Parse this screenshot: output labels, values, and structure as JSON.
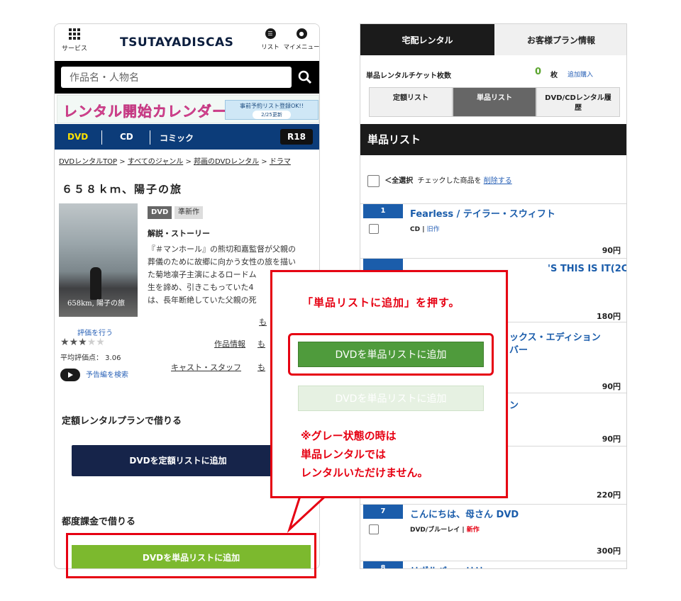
{
  "left": {
    "header": {
      "service_label": "サービス",
      "logo": "TSUTAYADISCAS",
      "list_label": "リスト",
      "mymenu_label": "マイメニュー"
    },
    "search": {
      "placeholder": "作品名・人物名"
    },
    "banner": {
      "title": "レンタル開始カレンダー",
      "box_text": "事前予約リスト登録OK!!",
      "box_date": "2/25更新"
    },
    "categories": [
      "DVD",
      "CD",
      "コミック"
    ],
    "r18": "R18",
    "breadcrumb": [
      "DVDレンタルTOP",
      "すべてのジャンル",
      "邦画のDVDレンタル",
      "ドラマ"
    ],
    "breadcrumb_sep": ">",
    "movie_title": "６５８ｋｍ、陽子の旅",
    "poster_text": "658km, 陽子の旅",
    "badges": {
      "format": "DVD",
      "status": "準新作"
    },
    "story_heading": "解説・ストーリー",
    "story_lines": [
      "『＃マンホール』の熊切和嘉監督が父親の",
      "葬儀のために故郷に向かう女性の旅を描い",
      "た菊地凛子主演によるロードム",
      "生を諦め、引きこもっていた4",
      "は、長年断絶していた父親の死"
    ],
    "more_links": [
      "も",
      "も",
      "も"
    ],
    "rate_link": "評価を行う",
    "stars": {
      "rating": 3,
      "max": 5
    },
    "avg_label": "平均評価点： 3.06",
    "trailer_link": "予告編を検索",
    "info_link": "作品情報",
    "cast_link": "キャスト・スタッフ",
    "plan_heading": "定額レンタルプランで借りる",
    "plan_button": "DVDを定額リストに追加",
    "pay_heading": "都度課金で借りる",
    "pay_button": "DVDを単品リストに追加"
  },
  "right": {
    "tabs": [
      "宅配レンタル",
      "お客様プラン情報"
    ],
    "ticket_label": "単品レンタルチケット枚数",
    "ticket_count": "0",
    "ticket_unit": "枚",
    "ticket_link": "追加購入",
    "sub_tabs": [
      "定額リスト",
      "単品リスト",
      "DVD/CDレンタル履\n歴"
    ],
    "list_heading": "単品リスト",
    "select_all": "＜全選択",
    "select_prefix": "チェックした商品を",
    "select_action": "削除する",
    "items": [
      {
        "num": "1",
        "title": "Fearless",
        "sub": " / テイラー・スウィフト",
        "media": "CD",
        "tag": "旧作",
        "price": "90円"
      },
      {
        "num": "",
        "title": "",
        "sub": "'S THIS IS IT(2CD) / マ",
        "media": "",
        "tag": "",
        "price": "180円"
      },
      {
        "num": "",
        "title": "",
        "sub": "ックス・エディション",
        "sub2": "バー",
        "media": "",
        "tag": "",
        "price": "90円"
      },
      {
        "num": "",
        "title": "",
        "sub": "ン",
        "media": "",
        "tag": "",
        "price": "90円"
      },
      {
        "num": "",
        "title": "",
        "sub": "",
        "media": "",
        "tag": "",
        "price": "220円"
      },
      {
        "num": "7",
        "title": "こんにちは、母さん DVD",
        "sub": "",
        "media": "DVD/ブルーレイ",
        "tag": "新作",
        "price": "300円"
      },
      {
        "num": "8",
        "title": "リボルバー・リリー",
        "sub": "",
        "media": "",
        "tag": "",
        "price": ""
      }
    ]
  },
  "callout": {
    "heading": "「単品リストに追加」を押す。",
    "active_button": "DVDを単品リストに追加",
    "disabled_button": "DVDを単品リストに追加",
    "note_lines": [
      "※グレー状態の時は",
      "単品レンタルでは",
      "レンタルいただけません。"
    ]
  },
  "colors": {
    "accent_red": "#e60012",
    "navy": "#0c3c79",
    "link_blue": "#2a62b7",
    "green": "#7cb92e"
  }
}
